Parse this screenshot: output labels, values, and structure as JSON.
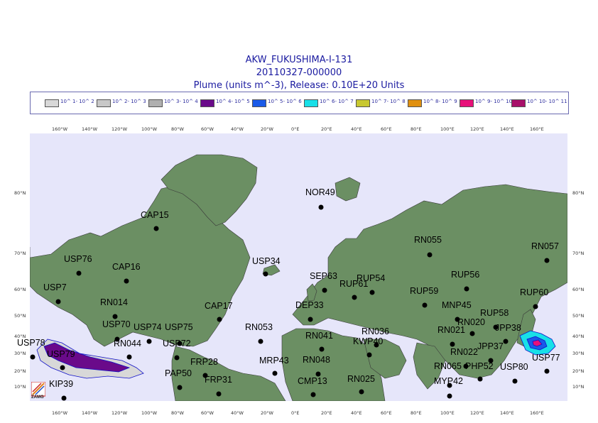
{
  "header": {
    "line1": "AKW_FUKUSHIMA-I-131",
    "line2": "20110327-000000",
    "line3": "Plume (units m^-3), Release:  0.10E+20 Units"
  },
  "legend": [
    {
      "label": "10^ 1- 10^ 2",
      "color": "#d8d8d8"
    },
    {
      "label": "10^ 2- 10^ 3",
      "color": "#c8c8c8"
    },
    {
      "label": "10^ 3- 10^ 4",
      "color": "#b0b0b0"
    },
    {
      "label": "10^ 4- 10^ 5",
      "color": "#6a0a8a"
    },
    {
      "label": "10^ 5- 10^ 6",
      "color": "#1a5ae8"
    },
    {
      "label": "10^ 6- 10^ 7",
      "color": "#18e0e8"
    },
    {
      "label": "10^ 7- 10^ 8",
      "color": "#c8c830"
    },
    {
      "label": "10^ 8- 10^ 9",
      "color": "#e09010"
    },
    {
      "label": "10^ 9- 10^ 10",
      "color": "#e8107a"
    },
    {
      "label": "10^ 10- 10^ 11",
      "color": "#a8106a"
    }
  ],
  "axis": {
    "lon_top": [
      "160°W",
      "140°W",
      "120°W",
      "100°W",
      "80°W",
      "60°W",
      "40°W",
      "20°W",
      "0°E",
      "20°E",
      "40°E",
      "60°E",
      "80°E",
      "100°E",
      "120°E",
      "140°E",
      "160°E"
    ],
    "lon_bottom": [
      "160°W",
      "140°W",
      "120°W",
      "100°W",
      "80°W",
      "60°W",
      "40°W",
      "20°W",
      "0°E",
      "20°E",
      "40°E",
      "60°E",
      "80°E",
      "100°E",
      "120°E",
      "140°E",
      "160°E"
    ],
    "lat_left": [
      "80°N",
      "70°N",
      "60°N",
      "50°N",
      "40°N",
      "30°N",
      "20°N",
      "10°N"
    ],
    "lat_right": [
      "80°N",
      "70°N",
      "60°N",
      "50°N",
      "40°N",
      "30°N",
      "20°N",
      "10°N"
    ]
  },
  "colors": {
    "ocean": "#e6e6fa",
    "land": "#6b8f63",
    "coast": "#3a3a3a",
    "contour": "#1010c8"
  },
  "stations": [
    {
      "id": "NOR49"
    },
    {
      "id": "CAP15"
    },
    {
      "id": "RN055"
    },
    {
      "id": "RN057"
    },
    {
      "id": "USP76"
    },
    {
      "id": "CAP16"
    },
    {
      "id": "USP34"
    },
    {
      "id": "SEP63"
    },
    {
      "id": "RUP54"
    },
    {
      "id": "RUP56"
    },
    {
      "id": "RUP61"
    },
    {
      "id": "USP7"
    },
    {
      "id": "RUP59"
    },
    {
      "id": "RUP60"
    },
    {
      "id": "RN014"
    },
    {
      "id": "CAP17"
    },
    {
      "id": "DEP33"
    },
    {
      "id": "MNP45"
    },
    {
      "id": "RUP58"
    },
    {
      "id": "USP70"
    },
    {
      "id": "USP74"
    },
    {
      "id": "USP75"
    },
    {
      "id": "RN053"
    },
    {
      "id": "RN020"
    },
    {
      "id": "RN036"
    },
    {
      "id": "RN021"
    },
    {
      "id": "JPP38"
    },
    {
      "id": "RN041"
    },
    {
      "id": "USP78"
    },
    {
      "id": "RN044"
    },
    {
      "id": "USP72"
    },
    {
      "id": "KWP40"
    },
    {
      "id": "JPP37"
    },
    {
      "id": "RN022"
    },
    {
      "id": "USP79"
    },
    {
      "id": "USP77"
    },
    {
      "id": "FRP28"
    },
    {
      "id": "MRP43"
    },
    {
      "id": "RN048"
    },
    {
      "id": "RN065"
    },
    {
      "id": "PHP52"
    },
    {
      "id": "USP80"
    },
    {
      "id": "PAP50"
    },
    {
      "id": "FRP31"
    },
    {
      "id": "RN025"
    },
    {
      "id": "CMP13"
    },
    {
      "id": "MYP42"
    },
    {
      "id": "KIP39"
    }
  ],
  "logo": {
    "text": "ZAMG"
  }
}
